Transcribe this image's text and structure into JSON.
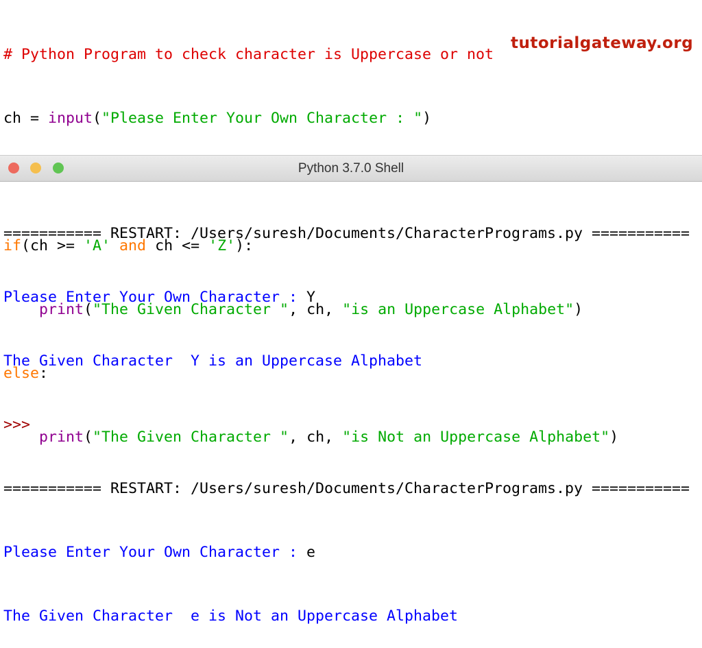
{
  "editor": {
    "l1": "# Python Program to check character is Uppercase or not",
    "l2": {
      "a": "ch = ",
      "b": "input",
      "c": "(",
      "d": "\"Please Enter Your Own Character : \"",
      "e": ")"
    },
    "l4": {
      "a": "if",
      "b": "(ch >= ",
      "c": "'A'",
      "d": " and ",
      "e": "ch <= ",
      "f": "'Z'",
      "g": "):"
    },
    "l5": {
      "a": "    ",
      "b": "print",
      "c": "(",
      "d": "\"The Given Character \"",
      "e": ", ch, ",
      "f": "\"is an Uppercase Alphabet\"",
      "g": ")"
    },
    "l6": {
      "a": "else",
      "b": ":"
    },
    "l7": {
      "a": "    ",
      "b": "print",
      "c": "(",
      "d": "\"The Given Character \"",
      "e": ", ch, ",
      "f": "\"is Not an Uppercase Alphabet\"",
      "g": ")"
    }
  },
  "watermark": "tutorialgateway.org",
  "window": {
    "title": "Python 3.7.0 Shell",
    "colors": {
      "close": "#ed6a5e",
      "minimize": "#f5bf4f",
      "zoom": "#61c554"
    }
  },
  "shell": {
    "restart1": "=========== RESTART: /Users/suresh/Documents/CharacterPrograms.py ===========",
    "prompt1": "Please Enter Your Own Character : ",
    "input1": "Y",
    "result1": "The Given Character  Y is an Uppercase Alphabet",
    "repl": ">>>",
    "restart2": "=========== RESTART: /Users/suresh/Documents/CharacterPrograms.py ===========",
    "prompt2": "Please Enter Your Own Character : ",
    "input2": "e",
    "result2": "The Given Character  e is Not an Uppercase Alphabet"
  }
}
